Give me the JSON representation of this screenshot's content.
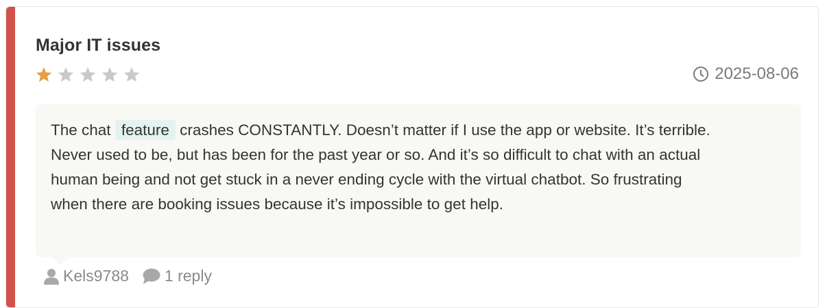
{
  "review": {
    "title": "Major IT issues",
    "rating": 1,
    "max_rating": 5,
    "date": "2025-08-06",
    "text_before": "The chat ",
    "highlight": "feature",
    "text_after": " crashes CONSTANTLY. Doesn’t matter if I use the app or website. It’s terrible. Never used to be, but has been for the past year or so. And it’s so difficult to chat with an actual human being and not get stuck in a never ending cycle with the virtual chatbot. So frustrating when there are booking issues because it’s impossible to get help.",
    "author": "Kels9788",
    "replies": "1 reply"
  },
  "colors": {
    "accent": "#d0524a",
    "star_filled": "#e3a04a",
    "star_empty": "#c9c9c9",
    "muted_text": "#8a8a8a",
    "highlight_bg": "#e3f3ef",
    "body_bg": "#f8f8f4"
  },
  "icons": {
    "star": "star-icon",
    "date": "clock-icon",
    "author": "user-icon",
    "replies": "comment-icon"
  }
}
